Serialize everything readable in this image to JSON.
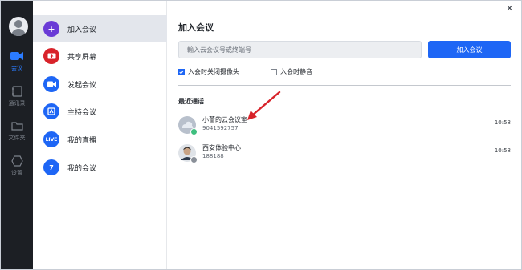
{
  "window": {
    "close_glyph": "✕"
  },
  "rail": {
    "items": [
      {
        "label": "会议",
        "icon": "video-camera-icon",
        "active": true
      },
      {
        "label": "通讯录",
        "icon": "contacts-icon",
        "active": false
      },
      {
        "label": "文件夹",
        "icon": "folder-icon",
        "active": false
      },
      {
        "label": "设置",
        "icon": "settings-hexagon-icon",
        "active": false
      }
    ]
  },
  "menu": {
    "items": [
      {
        "label": "加入会议",
        "icon": "plus-icon",
        "glyph": "+",
        "color": "#6a3bd6",
        "active": true
      },
      {
        "label": "共享屏幕",
        "icon": "share-screen-icon",
        "glyph": "",
        "color": "#d8232a",
        "active": false
      },
      {
        "label": "发起会议",
        "icon": "video-icon",
        "glyph": "",
        "color": "#1e66f5",
        "active": false
      },
      {
        "label": "主持会议",
        "icon": "host-icon",
        "glyph": "",
        "color": "#1e66f5",
        "active": false
      },
      {
        "label": "我的直播",
        "icon": "live-icon",
        "glyph": "LIVE",
        "color": "#1e66f5",
        "active": false
      },
      {
        "label": "我的会议",
        "icon": "calendar-icon",
        "glyph": "7",
        "color": "#1e66f5",
        "active": false
      }
    ]
  },
  "main": {
    "title": "加入会议",
    "input_placeholder": "輸入云会议号或終端号",
    "join_button": "加入会议",
    "options": [
      {
        "label": "入会时关闭摄像头",
        "checked": true
      },
      {
        "label": "入会时静音",
        "checked": false
      }
    ],
    "recent_title": "最近通话",
    "recent": [
      {
        "name": "小蕾的云会议室",
        "id": "9041592757",
        "time": "10:58",
        "avatar": "cloud-avatar-icon",
        "badge_color": "#3fbf7f"
      },
      {
        "name": "西安体验中心",
        "id": "188188",
        "time": "10:58",
        "avatar": "person-photo-avatar",
        "badge_color": "#8a9099"
      }
    ]
  },
  "colors": {
    "accent": "#1e66f5",
    "rail_bg": "#1c1f24",
    "arrow": "#d8232a"
  }
}
